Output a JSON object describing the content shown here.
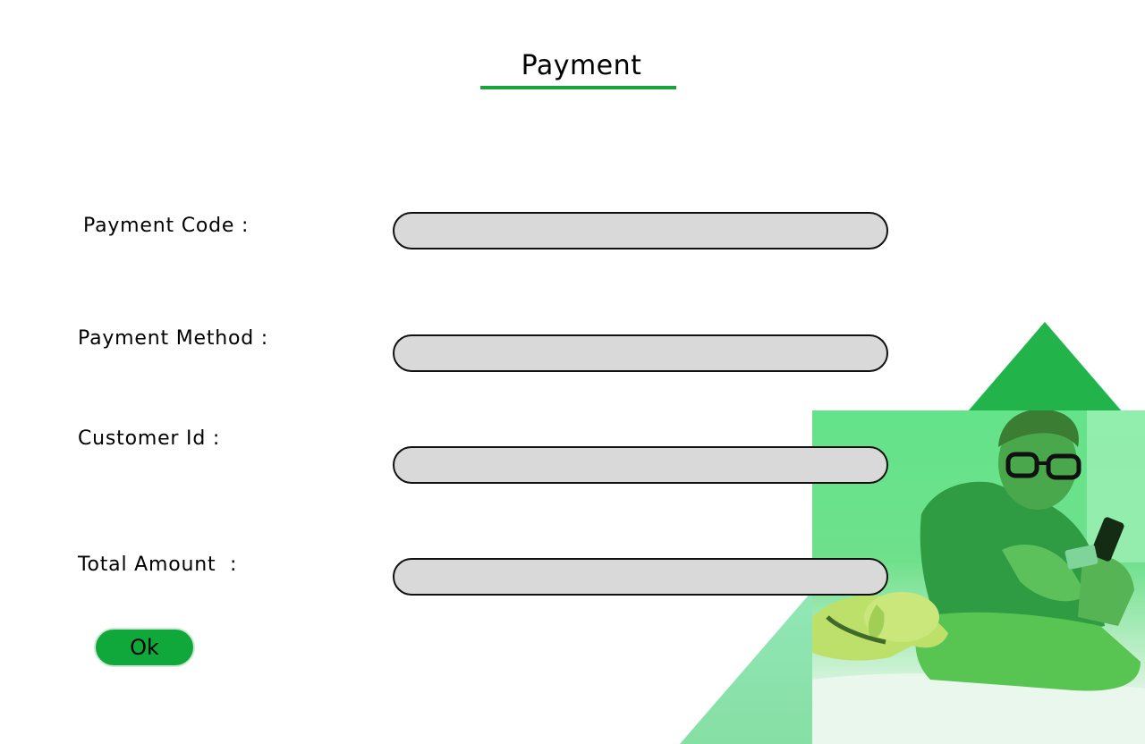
{
  "header": {
    "title": "Payment"
  },
  "form": {
    "fields": [
      {
        "label": "Payment Code :",
        "value": ""
      },
      {
        "label": "Payment Method :",
        "value": ""
      },
      {
        "label": "Customer Id :",
        "value": ""
      },
      {
        "label": "Total Amount  :",
        "value": ""
      }
    ],
    "submit_label": "Ok"
  },
  "decoration": {
    "photo_subject": "man-with-phone-and-dog-photo",
    "icon": "triangle-shape"
  },
  "colors": {
    "accent": "#1aa33b",
    "button": "#10a83a",
    "input_bg": "#d9d9d9",
    "triangle_light": "#7fd49a",
    "triangle_dark": "#22b44a"
  }
}
